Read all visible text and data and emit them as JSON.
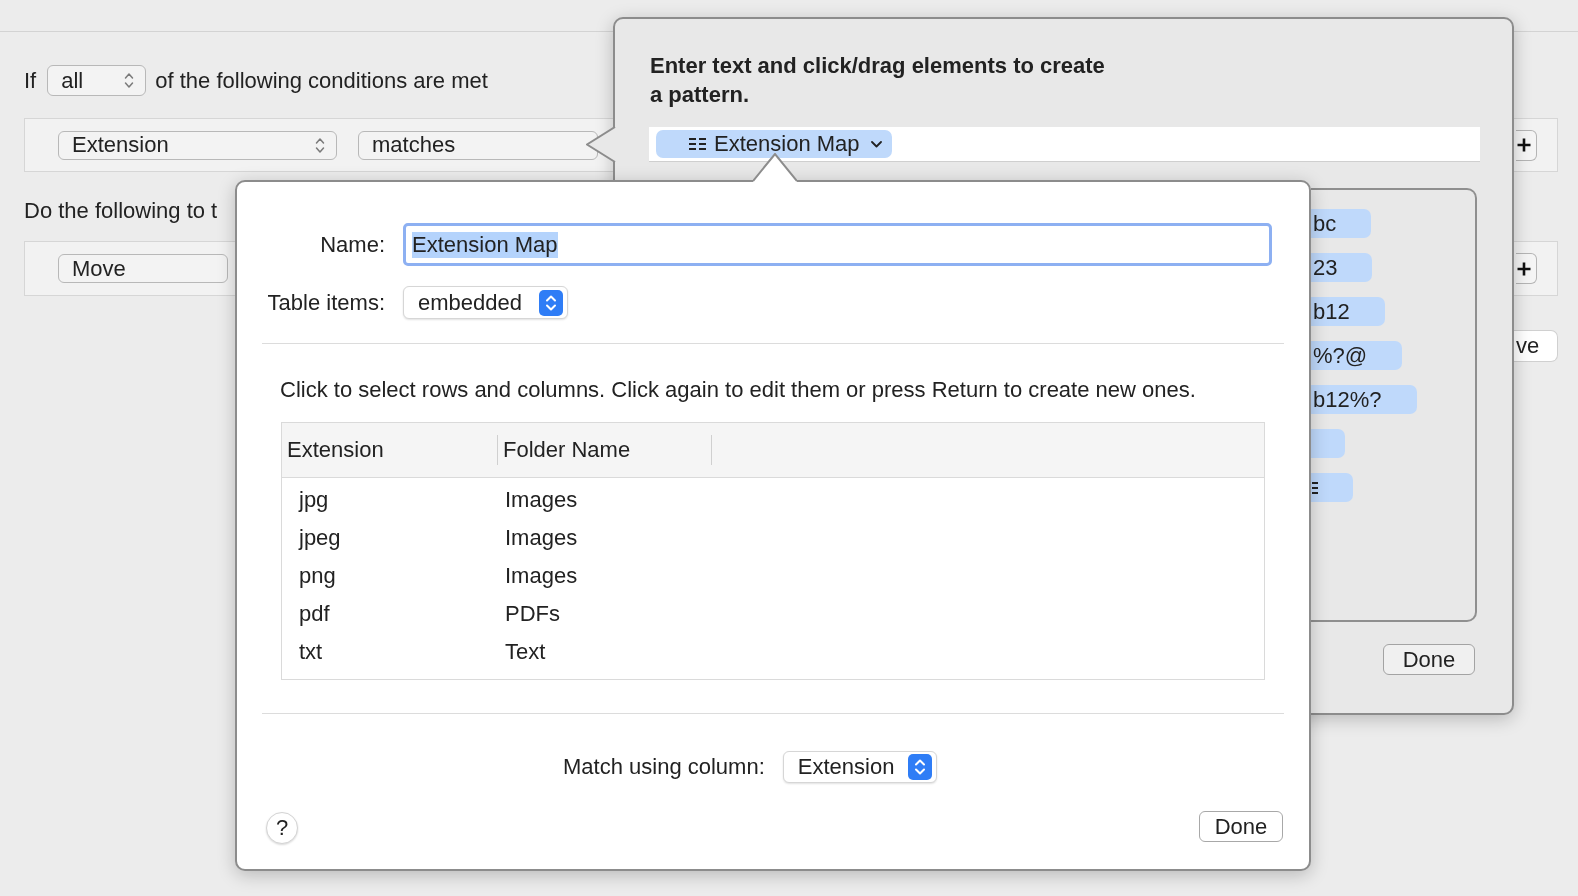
{
  "rules_window": {
    "match_line": {
      "prefix": "If",
      "quantifier": "all",
      "suffix": "of the following conditions are met"
    },
    "condition": {
      "attribute": "Extension",
      "operator": "matches"
    },
    "actions_heading": "Do the following to t",
    "action": {
      "verb": "Move"
    },
    "partial_button": "ve"
  },
  "pattern_popover": {
    "instructions": "Enter text and click/drag elements to create\na pattern.",
    "token": {
      "label": "Extension Map"
    },
    "elements": [
      {
        "kind": "text",
        "label": "bc"
      },
      {
        "kind": "text",
        "label": "23"
      },
      {
        "kind": "text",
        "label": "b12"
      },
      {
        "kind": "text",
        "label": "%?@"
      },
      {
        "kind": "text",
        "label": "b12%?"
      },
      {
        "kind": "blank"
      },
      {
        "kind": "icon"
      }
    ],
    "done_button": "Done"
  },
  "table_dialog": {
    "name_field": {
      "label": "Name:",
      "value": "Extension Map",
      "focused": true,
      "highlighted": true
    },
    "table_items": {
      "label": "Table items:",
      "value": "embedded"
    },
    "hint": "Click to select rows and columns. Click again to edit them or press Return to create new ones.",
    "table": {
      "columns": [
        "Extension",
        "Folder Name"
      ],
      "rows": [
        [
          "jpg",
          "Images"
        ],
        [
          "jpeg",
          "Images"
        ],
        [
          "png",
          "Images"
        ],
        [
          "pdf",
          "PDFs"
        ],
        [
          "txt",
          "Text"
        ]
      ]
    },
    "match_column": {
      "label": "Match using column:",
      "value": "Extension"
    },
    "help_button": "?",
    "done_button": "Done"
  }
}
